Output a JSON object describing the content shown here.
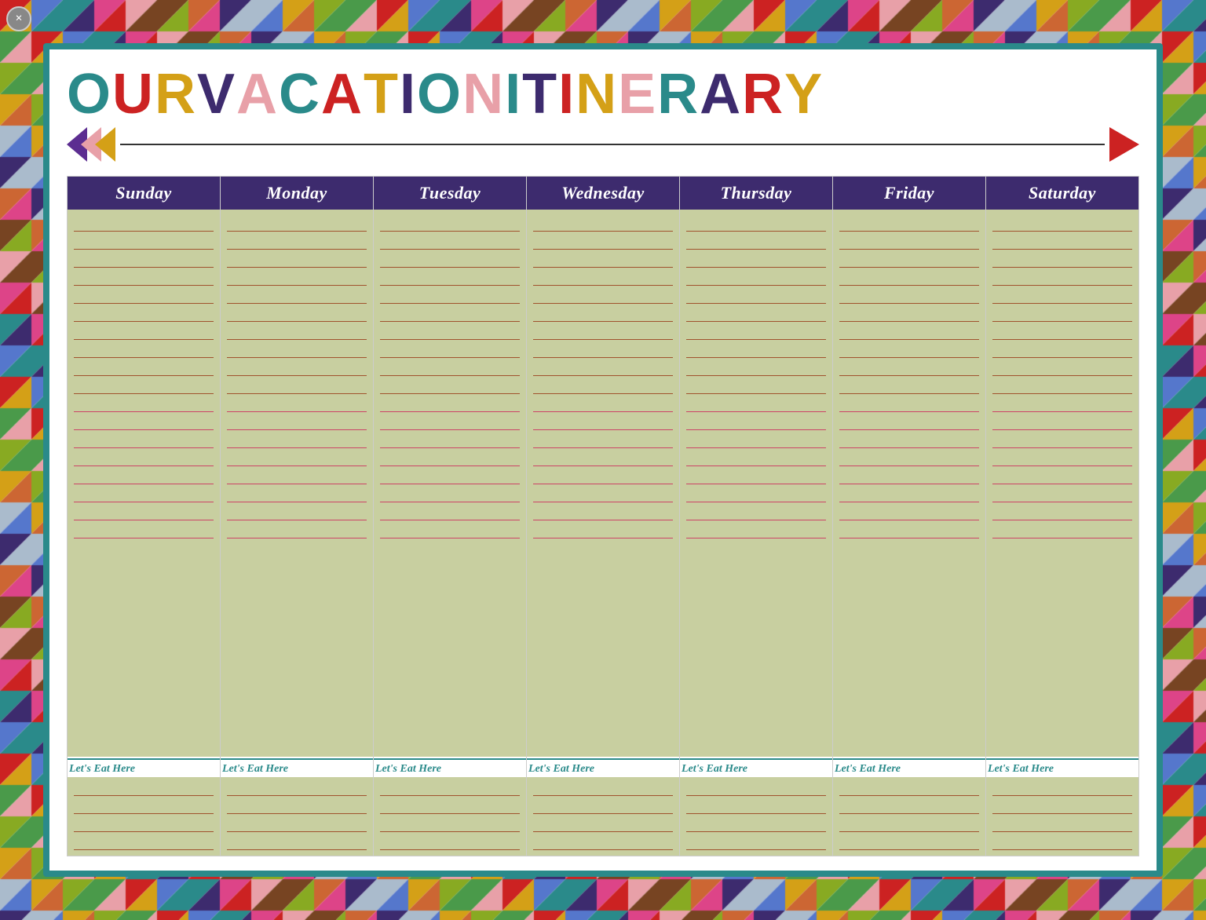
{
  "title": {
    "text": "OUR VACATION ITINERARY",
    "letters": [
      {
        "char": "O",
        "color": "#2a8a8a"
      },
      {
        "char": "U",
        "color": "#cc2222"
      },
      {
        "char": "R",
        "color": "#d4a017"
      },
      {
        "char": " ",
        "color": "#000"
      },
      {
        "char": "V",
        "color": "#3d2b6e"
      },
      {
        "char": "A",
        "color": "#e8a0a8"
      },
      {
        "char": "C",
        "color": "#2a8a8a"
      },
      {
        "char": "A",
        "color": "#cc2222"
      },
      {
        "char": "T",
        "color": "#d4a017"
      },
      {
        "char": "I",
        "color": "#3d2b6e"
      },
      {
        "char": "O",
        "color": "#2a8a8a"
      },
      {
        "char": "N",
        "color": "#e8a0a8"
      },
      {
        "char": " ",
        "color": "#000"
      },
      {
        "char": "I",
        "color": "#2a8a8a"
      },
      {
        "char": "T",
        "color": "#3d2b6e"
      },
      {
        "char": "I",
        "color": "#cc2222"
      },
      {
        "char": "N",
        "color": "#d4a017"
      },
      {
        "char": "E",
        "color": "#e8a0a8"
      },
      {
        "char": "R",
        "color": "#2a8a8a"
      },
      {
        "char": "A",
        "color": "#3d2b6e"
      },
      {
        "char": "R",
        "color": "#cc2222"
      },
      {
        "char": "Y",
        "color": "#d4a017"
      }
    ]
  },
  "days": [
    {
      "label": "Sunday"
    },
    {
      "label": "Monday"
    },
    {
      "label": "Tuesday"
    },
    {
      "label": "Wednesday"
    },
    {
      "label": "Thursday"
    },
    {
      "label": "Friday"
    },
    {
      "label": "Saturday"
    }
  ],
  "eats_label": "Let's Eat Here",
  "lines_per_day": 18,
  "eats_lines": 4,
  "close_button": "×"
}
